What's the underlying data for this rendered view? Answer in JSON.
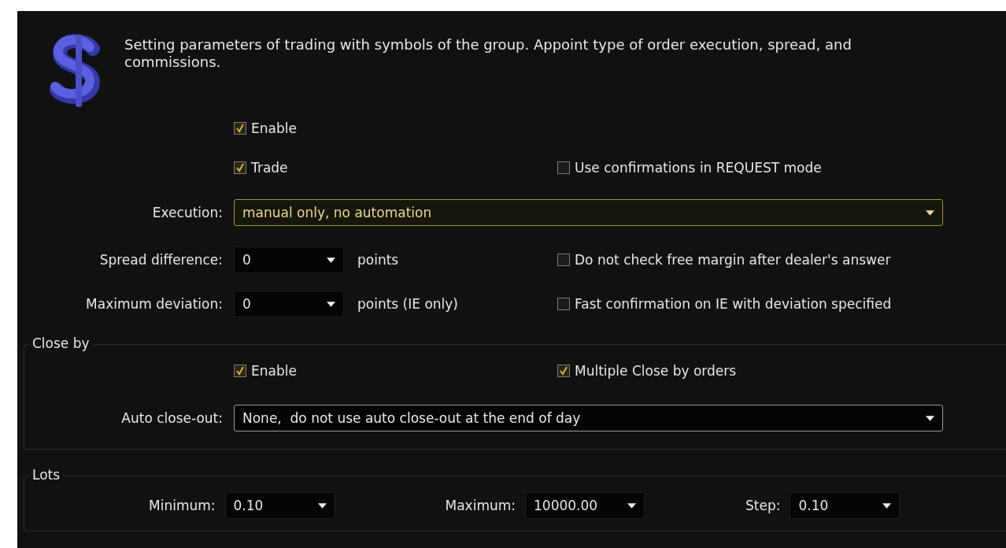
{
  "description": "Setting parameters of trading with symbols of the group. Appoint type of order execution, spread, and commissions.",
  "enable": {
    "label": "Enable",
    "checked": true
  },
  "trade": {
    "label": "Trade",
    "checked": true
  },
  "request_confirmations": {
    "label": "Use confirmations in REQUEST mode",
    "checked": false
  },
  "execution": {
    "label": "Execution:",
    "value": "manual only, no automation",
    "focused": true
  },
  "spread_difference": {
    "label": "Spread difference:",
    "value": "0",
    "unit": "points",
    "option": {
      "label": "Do not check free margin after dealer's answer",
      "checked": false
    }
  },
  "maximum_deviation": {
    "label": "Maximum deviation:",
    "value": "0",
    "unit": "points (IE only)",
    "option": {
      "label": "Fast confirmation on IE with deviation specified",
      "checked": false
    }
  },
  "close_by": {
    "title": "Close by",
    "enable": {
      "label": "Enable",
      "checked": true
    },
    "multiple": {
      "label": "Multiple Close by orders",
      "checked": true
    },
    "auto_close_out": {
      "label": "Auto close-out:",
      "value": "None,  do not use auto close-out at the end of day",
      "focused": false
    }
  },
  "lots": {
    "title": "Lots",
    "fields": [
      {
        "label": "Minimum:",
        "value": "0.10"
      },
      {
        "label": "Maximum:",
        "value": "10000.00"
      },
      {
        "label": "Step:",
        "value": "0.10"
      }
    ]
  }
}
